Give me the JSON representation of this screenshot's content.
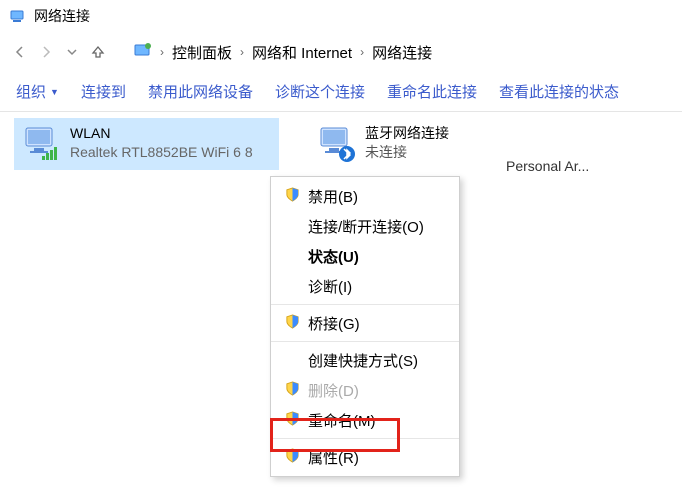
{
  "window": {
    "title": "网络连接"
  },
  "breadcrumb": {
    "root_icon": "control-panel-icon",
    "items": [
      "控制面板",
      "网络和 Internet",
      "网络连接"
    ]
  },
  "toolbar": {
    "organize": "组织",
    "connect": "连接到",
    "disable": "禁用此网络设备",
    "diagnose": "诊断这个连接",
    "rename": "重命名此连接",
    "status": "查看此连接的状态"
  },
  "adapters": [
    {
      "name": "WLAN",
      "line2": "",
      "line3": "Realtek RTL8852BE WiFi 6 8",
      "selected": true,
      "icon": "wifi-adapter"
    },
    {
      "name": "蓝牙网络连接",
      "line2": "未连接",
      "line3": "",
      "selected": false,
      "icon": "bluetooth-adapter"
    }
  ],
  "extra_text": "Personal Ar...",
  "context_menu": {
    "items": [
      {
        "label": "禁用(B)",
        "shield": true
      },
      {
        "label": "连接/断开连接(O)",
        "shield": false
      },
      {
        "label": "状态(U)",
        "shield": false,
        "bold": true
      },
      {
        "label": "诊断(I)",
        "shield": false
      },
      {
        "sep": true
      },
      {
        "label": "桥接(G)",
        "shield": true
      },
      {
        "sep": true
      },
      {
        "label": "创建快捷方式(S)",
        "shield": false
      },
      {
        "label": "删除(D)",
        "shield": true,
        "disabled": true
      },
      {
        "label": "重命名(M)",
        "shield": true
      },
      {
        "sep": true
      },
      {
        "label": "属性(R)",
        "shield": true,
        "highlight": true
      }
    ]
  }
}
